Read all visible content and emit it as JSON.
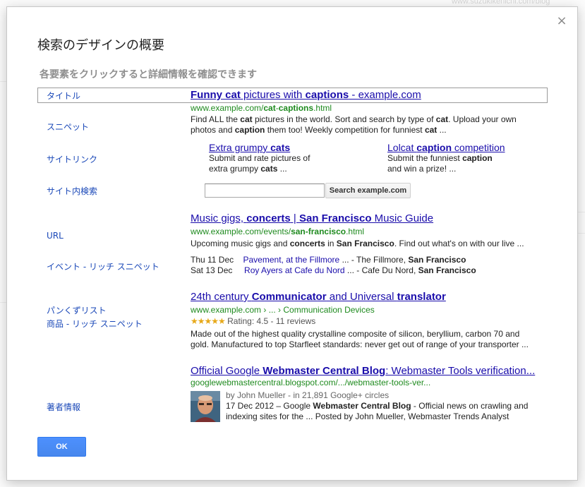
{
  "background": {
    "url_text": "www.suzukikenichi.com/blog"
  },
  "dialog": {
    "close_glyph": "×",
    "title": "検索のデザインの概要",
    "subtitle": "各要素をクリックすると詳細情報を確認できます",
    "ok_label": "OK"
  },
  "labels": {
    "title": "タイトル",
    "snippet": "スニペット",
    "sitelinks": "サイトリンク",
    "site_search": "サイト内検索",
    "url": "URL",
    "event": "イベント - リッチ スニペット",
    "breadcrumb": "パンくずリスト",
    "product": "商品 - リッチ スニペット",
    "author": "著者情報"
  },
  "result1": {
    "title_a": "Funny cat",
    "title_b": " pictures with ",
    "title_c": "captions",
    "title_d": " - example.com",
    "url_a": "www.example.com/",
    "url_b": "cat",
    "url_c": "-",
    "url_d": "captions",
    "url_e": ".html",
    "snip1_a": "Find ALL the ",
    "snip1_b": "cat",
    "snip1_c": " pictures in the world. Sort and search by type of ",
    "snip1_d": "cat",
    "snip1_e": ". Upload your own",
    "snip2_a": "photos and ",
    "snip2_b": "caption",
    "snip2_c": " them too! Weekly competition for funniest ",
    "snip2_d": "cat",
    "snip2_e": " ...",
    "sitelink1_title_a": "Extra grumpy ",
    "sitelink1_title_b": "cats",
    "sitelink1_line1": "Submit and rate pictures of",
    "sitelink1_line2_a": "extra grumpy ",
    "sitelink1_line2_b": "cats",
    "sitelink1_line2_c": " ...",
    "sitelink2_title_a": "Lolcat ",
    "sitelink2_title_b": "caption",
    "sitelink2_title_c": " competition",
    "sitelink2_line1_a": "Submit the funniest ",
    "sitelink2_line1_b": "caption",
    "sitelink2_line2": "and win a prize! ...",
    "search_placeholder": "",
    "search_button": "Search example.com"
  },
  "result2": {
    "title_a": "Music gigs, ",
    "title_b": "concerts",
    "title_c": " | ",
    "title_d": "San Francisco",
    "title_e": " Music Guide",
    "url_a": "www.example.com/events/",
    "url_b": "san-francisco",
    "url_c": ".html",
    "snip_a": "Upcoming music gigs and ",
    "snip_b": "concerts",
    "snip_c": " in ",
    "snip_d": "San Francisco",
    "snip_e": ". Find out what's on with our live ...",
    "events": [
      {
        "date": "Thu 11 Dec",
        "link": "Pavement, at the Fillmore",
        "rest_a": " ... - The Fillmore, ",
        "rest_b": "San Francisco"
      },
      {
        "date": "Sat 13 Dec",
        "link": "Roy Ayers at Cafe du Nord",
        "rest_a": " ... - Cafe Du Nord, ",
        "rest_b": "San Francisco"
      }
    ]
  },
  "result3": {
    "title_a": "24th century ",
    "title_b": "Communicator",
    "title_c": " and Universal ",
    "title_d": "translator",
    "breadcrumb": "www.example.com › ... › Communication Devices",
    "stars": "★★★★★",
    "rating": " Rating: 4.5 - 11 reviews",
    "snip1": "Made out of the highest quality crystalline composite of silicon, beryllium, carbon 70 and",
    "snip2": "gold. Manufactured to top Starfleet standards: never get out of range of your transporter ..."
  },
  "result4": {
    "title_a": "Official Google ",
    "title_b": "Webmaster Central Blog",
    "title_c": ": Webmaster Tools verification...",
    "url": "googlewebmastercentral.blogspot.com/.../webmaster-tools-ver...",
    "byline": "by John Mueller - in 21,891 Google+ circles",
    "snip1_a": "17 Dec 2012 – Google ",
    "snip1_b": "Webmaster Central Blog",
    "snip1_c": " - Official news on crawling and",
    "snip2": "indexing  sites for the ... Posted by John Mueller, Webmaster Trends Analyst"
  },
  "colors": {
    "label_blue": "#1a48b8",
    "link_blue": "#1a0dab",
    "url_green": "#1e8a1e",
    "star_gold": "#e7a91a",
    "ok_blue": "#4787ed"
  }
}
